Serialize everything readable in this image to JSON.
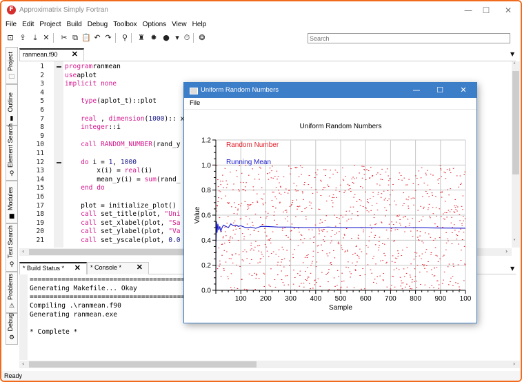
{
  "app": {
    "title": "Approximatrix Simply Fortran",
    "logo_glyph": "F",
    "window_controls": {
      "minimize": "—",
      "maximize": "☐",
      "close": "✕"
    }
  },
  "menu": [
    "File",
    "Edit",
    "Project",
    "Build",
    "Debug",
    "Toolbox",
    "Options",
    "View",
    "Help"
  ],
  "toolbar": {
    "icons": [
      {
        "name": "new-file-icon",
        "glyph": "⊡"
      },
      {
        "name": "open-icon",
        "glyph": "⇪"
      },
      {
        "name": "save-icon",
        "glyph": "⤓"
      },
      {
        "name": "close-file-icon",
        "glyph": "✕"
      },
      {
        "name": "cut-icon",
        "glyph": "✂"
      },
      {
        "name": "copy-icon",
        "glyph": "⧉"
      },
      {
        "name": "paste-icon",
        "glyph": "📋"
      },
      {
        "name": "undo-icon",
        "glyph": "↶"
      },
      {
        "name": "redo-icon",
        "glyph": "↷"
      },
      {
        "name": "find-icon",
        "glyph": "⚲"
      },
      {
        "name": "build-icon",
        "glyph": "♜"
      },
      {
        "name": "settings-icon",
        "glyph": "✹"
      },
      {
        "name": "run-icon",
        "glyph": "●"
      },
      {
        "name": "run-dropdown-icon",
        "glyph": "▾"
      },
      {
        "name": "timer-icon",
        "glyph": "⏱"
      },
      {
        "name": "debug-icon",
        "glyph": "❂"
      }
    ],
    "search_placeholder": "Search"
  },
  "sidebar": {
    "tabs": [
      {
        "label": "Project",
        "icon": "🗀"
      },
      {
        "label": "Outline",
        "icon": "▮"
      },
      {
        "label": "Element Search",
        "icon": "⚲"
      },
      {
        "label": "Modules",
        "icon": "■"
      },
      {
        "label": "Text Search",
        "icon": "⚲"
      },
      {
        "label": "Problems",
        "icon": "⚠"
      },
      {
        "label": "Debug",
        "icon": "⚙"
      }
    ]
  },
  "editor": {
    "tab_label": "ranmean.f90",
    "close_glyph": "✕",
    "lines": [
      {
        "n": "1",
        "parts": [
          [
            "kw",
            "program"
          ],
          [
            "",
            "ranmean"
          ]
        ]
      },
      {
        "n": "2",
        "parts": [
          [
            "kw",
            "use"
          ],
          [
            "",
            "aplot"
          ]
        ]
      },
      {
        "n": "3",
        "parts": [
          [
            "kw",
            "implicit none"
          ]
        ]
      },
      {
        "n": "4",
        "parts": []
      },
      {
        "n": "5",
        "parts": [
          [
            "",
            "    "
          ],
          [
            "kw",
            "type"
          ],
          [
            "",
            "(aplot_t)::plot"
          ]
        ]
      },
      {
        "n": "6",
        "parts": []
      },
      {
        "n": "7",
        "parts": [
          [
            "",
            "    "
          ],
          [
            "kw",
            "real"
          ],
          [
            "",
            " , "
          ],
          [
            "kw",
            "dimension"
          ],
          [
            "",
            "("
          ],
          [
            "num",
            "1000"
          ],
          [
            "",
            "):: x,"
          ]
        ]
      },
      {
        "n": "8",
        "parts": [
          [
            "",
            "    "
          ],
          [
            "kw",
            "integer"
          ],
          [
            "",
            "::i"
          ]
        ]
      },
      {
        "n": "9",
        "parts": []
      },
      {
        "n": "10",
        "parts": [
          [
            "",
            "    "
          ],
          [
            "kw",
            "call"
          ],
          [
            "kw",
            " RANDOM_NUMBER"
          ],
          [
            "",
            "(rand_y"
          ]
        ]
      },
      {
        "n": "11",
        "parts": []
      },
      {
        "n": "12",
        "parts": [
          [
            "",
            "    "
          ],
          [
            "kw",
            "do"
          ],
          [
            "",
            " i = "
          ],
          [
            "num",
            "1"
          ],
          [
            "",
            ", "
          ],
          [
            "num",
            "1000"
          ]
        ]
      },
      {
        "n": "13",
        "parts": [
          [
            "",
            "        x(i) = "
          ],
          [
            "kw",
            "real"
          ],
          [
            "",
            "(i)"
          ]
        ]
      },
      {
        "n": "14",
        "parts": [
          [
            "",
            "        mean_y(i) = "
          ],
          [
            "kw",
            "sum"
          ],
          [
            "",
            "(rand_"
          ]
        ]
      },
      {
        "n": "15",
        "parts": [
          [
            "",
            "    "
          ],
          [
            "kw",
            "end do"
          ]
        ]
      },
      {
        "n": "16",
        "parts": []
      },
      {
        "n": "17",
        "parts": [
          [
            "",
            "    plot = initialize_plot()"
          ]
        ]
      },
      {
        "n": "18",
        "parts": [
          [
            "",
            "    "
          ],
          [
            "kw",
            "call"
          ],
          [
            "",
            " set_title(plot, "
          ],
          [
            "kw",
            "\"Uni"
          ]
        ]
      },
      {
        "n": "19",
        "parts": [
          [
            "",
            "    "
          ],
          [
            "kw",
            "call"
          ],
          [
            "",
            " set_xlabel(plot, "
          ],
          [
            "kw",
            "\"Sa"
          ]
        ]
      },
      {
        "n": "20",
        "parts": [
          [
            "",
            "    "
          ],
          [
            "kw",
            "call"
          ],
          [
            "",
            " set_ylabel(plot, "
          ],
          [
            "kw",
            "\"Va"
          ]
        ]
      },
      {
        "n": "21",
        "parts": [
          [
            "",
            "    "
          ],
          [
            "kw",
            "call"
          ],
          [
            "",
            " set_yscale(plot, "
          ],
          [
            "num",
            "0.0"
          ]
        ]
      }
    ]
  },
  "bottom_panel": {
    "tabs": [
      {
        "label": "* Build Status *",
        "close": "✕"
      },
      {
        "label": "* Console *",
        "close": "✕"
      }
    ],
    "output_lines": [
      "==============================================================================",
      "Generating Makefile... Okay",
      "==============================================================================",
      "Compiling .\\ranmean.f90",
      "Generating ranmean.exe",
      "",
      "* Complete *"
    ]
  },
  "status_bar": {
    "text": "Ready"
  },
  "plot_window": {
    "title": "Uniform Random Numbers",
    "menu": [
      "File"
    ],
    "controls": {
      "minimize": "—",
      "maximize": "☐",
      "close": "✕"
    }
  },
  "colors": {
    "accent_frame": "#f26b1d",
    "plot_window_title": "#3d7ec9",
    "keyword": "#d4198f",
    "random_series": "#e0202a",
    "mean_series": "#1a1acc"
  },
  "chart_data": {
    "type": "scatter",
    "title": "Uniform Random Numbers",
    "xlabel": "Sample",
    "ylabel": "Value",
    "xlim": [
      0,
      1000
    ],
    "ylim": [
      0.0,
      1.2
    ],
    "xticks": [
      "100",
      "200",
      "300",
      "400",
      "500",
      "600",
      "700",
      "800",
      "900",
      "100"
    ],
    "yticks": [
      "0.0",
      "0.2",
      "0.4",
      "0.6",
      "0.8",
      "1.0",
      "1.2"
    ],
    "grid": true,
    "legend_placement": "top-left",
    "series": [
      {
        "name": "Random Number",
        "kind": "scatter",
        "color": "#e0202a",
        "n": 1000,
        "distribution": "uniform[0,1]"
      },
      {
        "name": "Running Mean",
        "kind": "line",
        "color": "#1a1acc",
        "x": [
          1,
          3,
          5,
          8,
          12,
          16,
          20,
          25,
          30,
          40,
          50,
          60,
          70,
          80,
          90,
          100,
          120,
          140,
          160,
          180,
          200,
          250,
          300,
          350,
          400,
          450,
          500,
          600,
          700,
          800,
          900,
          1000
        ],
        "y": [
          0.39,
          0.55,
          0.46,
          0.53,
          0.48,
          0.51,
          0.47,
          0.5,
          0.52,
          0.51,
          0.5,
          0.53,
          0.515,
          0.52,
          0.51,
          0.515,
          0.5,
          0.505,
          0.495,
          0.51,
          0.51,
          0.505,
          0.505,
          0.5,
          0.5,
          0.505,
          0.5,
          0.5,
          0.498,
          0.5,
          0.497,
          0.496
        ]
      }
    ]
  }
}
